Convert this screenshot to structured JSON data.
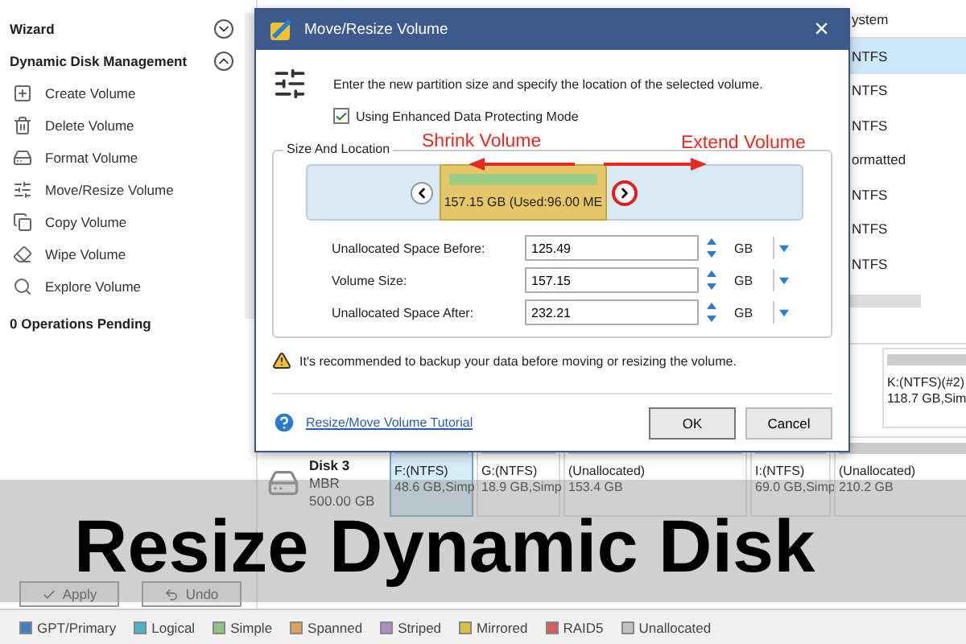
{
  "sidebar": {
    "sections": [
      {
        "title": "Wizard",
        "expanded": false
      },
      {
        "title": "Dynamic Disk Management",
        "expanded": true,
        "items": [
          {
            "kind": "create",
            "label": "Create Volume"
          },
          {
            "kind": "delete",
            "label": "Delete Volume"
          },
          {
            "kind": "format",
            "label": "Format Volume"
          },
          {
            "kind": "resize",
            "label": "Move/Resize Volume"
          },
          {
            "kind": "copy",
            "label": "Copy Volume"
          },
          {
            "kind": "wipe",
            "label": "Wipe Volume"
          },
          {
            "kind": "explore",
            "label": "Explore Volume"
          }
        ]
      }
    ],
    "pending": "0 Operations Pending",
    "buttons": [
      {
        "kind": "apply",
        "label": "Apply",
        "disabled": true
      },
      {
        "kind": "undo",
        "label": "Undo",
        "disabled": true
      }
    ]
  },
  "table": {
    "columns": [
      "ystem"
    ],
    "rows": [
      {
        "cells": [
          "NTFS"
        ],
        "selected": true
      },
      {
        "cells": [
          "NTFS"
        ],
        "selected": false
      },
      {
        "cells": [
          "NTFS"
        ],
        "selected": false
      },
      {
        "cells": [
          "ormatted"
        ],
        "selected": false
      },
      {
        "cells": [
          "NTFS"
        ],
        "selected": false
      },
      {
        "cells": [
          "NTFS"
        ],
        "selected": false
      },
      {
        "cells": [
          "NTFS"
        ],
        "selected": false
      }
    ]
  },
  "disk_map": [
    {
      "partitions": [
        {
          "label": "K:(NTFS)(#2)",
          "detail": "118.7 GB,Sim",
          "selected": false
        }
      ]
    },
    {
      "name": "Disk 3",
      "type": "MBR",
      "size": "500.00 GB",
      "partitions": [
        {
          "label": "F:(NTFS)",
          "detail": "48.6 GB,Simp",
          "selected": true
        },
        {
          "label": "G:(NTFS)",
          "detail": "18.9 GB,Simp",
          "selected": false
        },
        {
          "label": "(Unallocated)",
          "detail": "153.4 GB",
          "selected": false
        },
        {
          "label": "I:(NTFS)",
          "detail": "69.0 GB,Simp",
          "selected": false
        },
        {
          "label": "(Unallocated)",
          "detail": "210.2 GB",
          "selected": false
        }
      ]
    }
  ],
  "legend": [
    {
      "label": "GPT/Primary",
      "color": "#4a7ab8"
    },
    {
      "label": "Logical",
      "color": "#48b4c8"
    },
    {
      "label": "Simple",
      "color": "#8cc47c"
    },
    {
      "label": "Spanned",
      "color": "#d8a060"
    },
    {
      "label": "Striped",
      "color": "#b08cc0"
    },
    {
      "label": "Mirrored",
      "color": "#d8c040"
    },
    {
      "label": "RAID5",
      "color": "#d85c5c"
    },
    {
      "label": "Unallocated",
      "color": "#c0c0c0"
    }
  ],
  "dialog": {
    "title": "Move/Resize Volume",
    "close": "×",
    "intro": "Enter the new partition size and specify the location of the selected volume.",
    "option": {
      "label": "Using Enhanced Data Protecting Mode",
      "checked": true
    },
    "annotations": {
      "shrink": "Shrink Volume",
      "extend": "Extend Volume"
    },
    "group_title": "Size And Location",
    "partition_bar": {
      "text": "157.15 GB (Used:96.00 ME"
    },
    "fields": [
      {
        "label": "Unallocated Space Before:",
        "value": "125.49",
        "unit": "GB"
      },
      {
        "label": "Volume Size:",
        "value": "157.15",
        "unit": "GB"
      },
      {
        "label": "Unallocated Space After:",
        "value": "232.21",
        "unit": "GB"
      }
    ],
    "warning": "It's recommended to backup your data before moving or resizing the volume.",
    "help_link": "Resize/Move Volume Tutorial",
    "buttons": [
      "OK",
      "Cancel"
    ]
  },
  "banner": {
    "title": "Resize Dynamic Disk"
  }
}
